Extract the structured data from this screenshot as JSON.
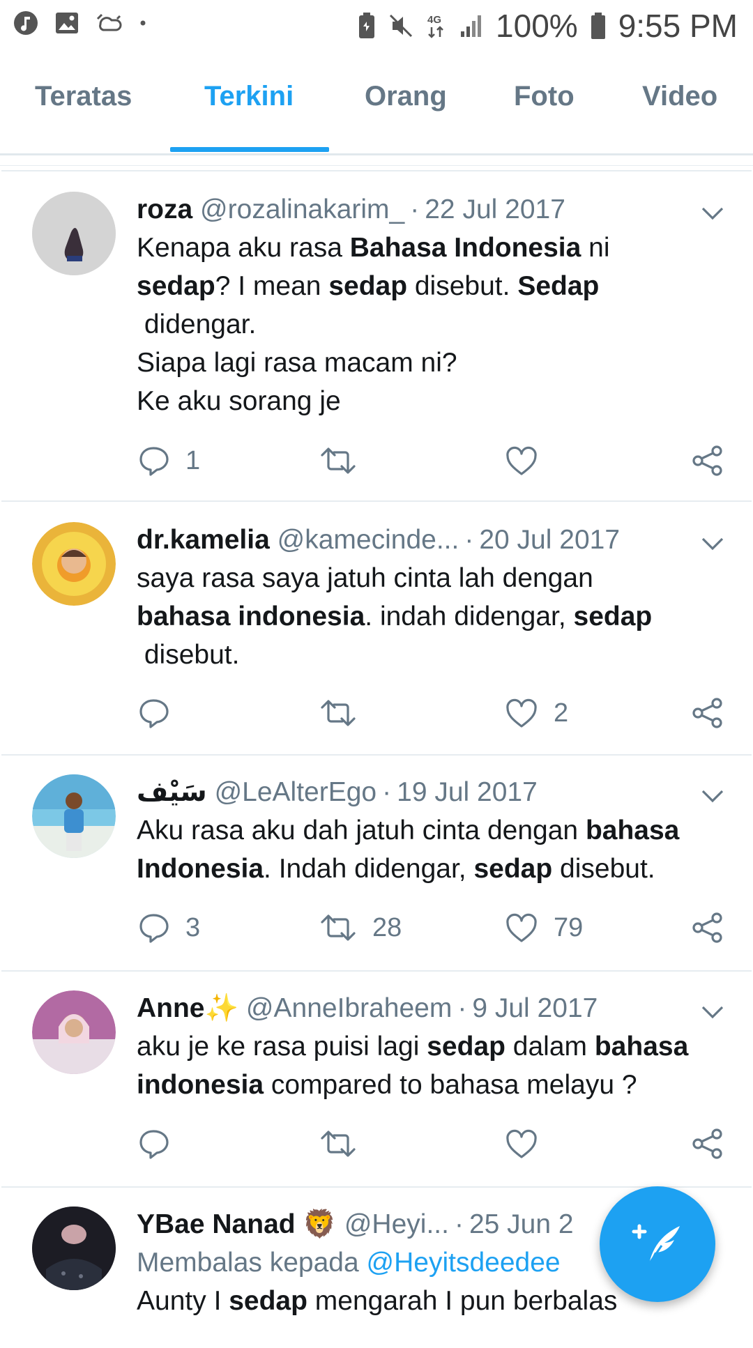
{
  "status_bar": {
    "battery": "100%",
    "time": "9:55 PM",
    "network": "4G"
  },
  "tabs": [
    {
      "label": "Teratas"
    },
    {
      "label": "Terkini"
    },
    {
      "label": "Orang"
    },
    {
      "label": "Foto"
    },
    {
      "label": "Video"
    }
  ],
  "active_tab": "Terkini",
  "tweets": [
    {
      "name": "roza",
      "handle": "@rozalinakarim_",
      "date": "22 Jul 2017",
      "lines": [
        [
          {
            "t": "Kenapa aku rasa "
          },
          {
            "t": "Bahasa Indonesia",
            "b": true
          },
          {
            "t": " ni"
          }
        ],
        [
          {
            "t": "sedap",
            "b": true
          },
          {
            "t": "? I mean "
          },
          {
            "t": "sedap",
            "b": true
          },
          {
            "t": " disebut. "
          },
          {
            "t": "Sedap",
            "b": true
          }
        ],
        [
          {
            "t": " didengar."
          }
        ],
        [
          {
            "t": "Siapa lagi rasa macam ni?"
          }
        ],
        [
          {
            "t": "Ke aku sorang je"
          }
        ]
      ],
      "reply_count": "1",
      "retweet_count": "",
      "like_count": ""
    },
    {
      "name": "dr.kamelia",
      "handle": "@kamecinde...",
      "date": "20 Jul 2017",
      "lines": [
        [
          {
            "t": "saya rasa saya jatuh cinta lah dengan"
          }
        ],
        [
          {
            "t": "bahasa indonesia",
            "b": true
          },
          {
            "t": ". indah didengar, "
          },
          {
            "t": "sedap",
            "b": true
          }
        ],
        [
          {
            "t": " disebut."
          }
        ]
      ],
      "reply_count": "",
      "retweet_count": "",
      "like_count": "2"
    },
    {
      "name": "سَيْف",
      "handle": "@LeAlterEgo",
      "date": "19 Jul 2017",
      "lines": [
        [
          {
            "t": "Aku rasa aku dah jatuh cinta dengan "
          },
          {
            "t": "bahasa",
            "b": true
          }
        ],
        [
          {
            "t": "Indonesia",
            "b": true
          },
          {
            "t": ". Indah didengar, "
          },
          {
            "t": "sedap",
            "b": true
          },
          {
            "t": " disebut."
          }
        ]
      ],
      "reply_count": "3",
      "retweet_count": "28",
      "like_count": "79"
    },
    {
      "name": "Anne✨",
      "handle": "@AnneIbraheem",
      "date": "9 Jul 2017",
      "lines": [
        [
          {
            "t": "aku je ke rasa puisi lagi "
          },
          {
            "t": "sedap",
            "b": true
          },
          {
            "t": " dalam "
          },
          {
            "t": "bahasa",
            "b": true
          }
        ],
        [
          {
            "t": "indonesia",
            "b": true
          },
          {
            "t": " compared to bahasa melayu ?"
          }
        ]
      ],
      "reply_count": "",
      "retweet_count": "",
      "like_count": ""
    },
    {
      "name": "YBae Nanad 🦁",
      "handle": "@Heyi...",
      "date": "25 Jun 2",
      "reply_prefix": "Membalas kepada ",
      "reply_to": "@Heyitsdeedee",
      "lines": [
        [
          {
            "t": "Aunty I "
          },
          {
            "t": "sedap",
            "b": true
          },
          {
            "t": " mengarah I pun berbalas"
          }
        ]
      ]
    }
  ],
  "colors": {
    "accent": "#1da1f2",
    "secondary_text": "#657786",
    "primary_text": "#14171a",
    "divider": "#e6ecf0"
  },
  "icons": [
    "reply-icon",
    "retweet-icon",
    "like-icon",
    "share-icon",
    "chevron-down-icon",
    "compose-tweet-icon"
  ]
}
